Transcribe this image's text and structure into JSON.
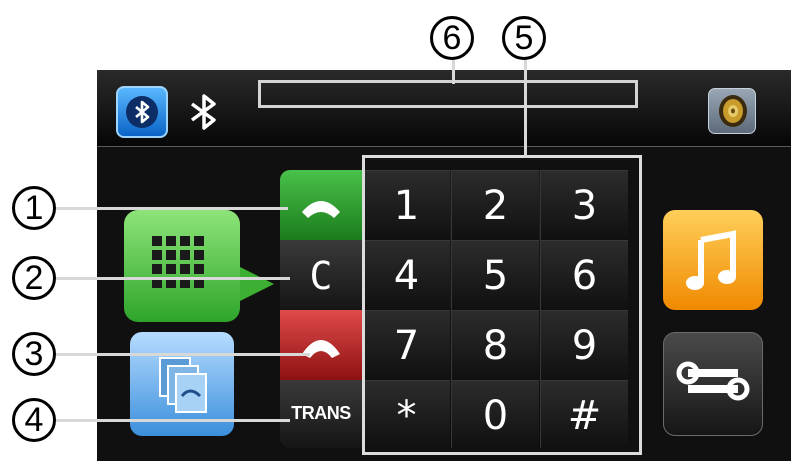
{
  "callouts": [
    "1",
    "2",
    "3",
    "4",
    "5",
    "6"
  ],
  "header": {
    "status_text": ""
  },
  "actions": {
    "clear_label": "C",
    "trans_label": "TRANS"
  },
  "keypad": {
    "keys": [
      "1",
      "2",
      "3",
      "4",
      "5",
      "6",
      "7",
      "8",
      "9",
      "*",
      "0",
      "#"
    ]
  },
  "colors": {
    "call": "#2e9a2f",
    "hangup": "#c22020",
    "keypad_tile": "#3db034",
    "contacts_tile": "#5aa7ea",
    "music_tile": "#f5a000",
    "bluetooth": "#1a7ee0"
  },
  "icons": {
    "bluetooth": "bluetooth-icon",
    "volume": "speaker-icon",
    "call": "phone-answer-icon",
    "hangup": "phone-hangup-icon",
    "keypad": "dialpad-icon",
    "contacts": "contacts-icon",
    "music": "music-note-icon",
    "settings": "wrench-icon"
  }
}
